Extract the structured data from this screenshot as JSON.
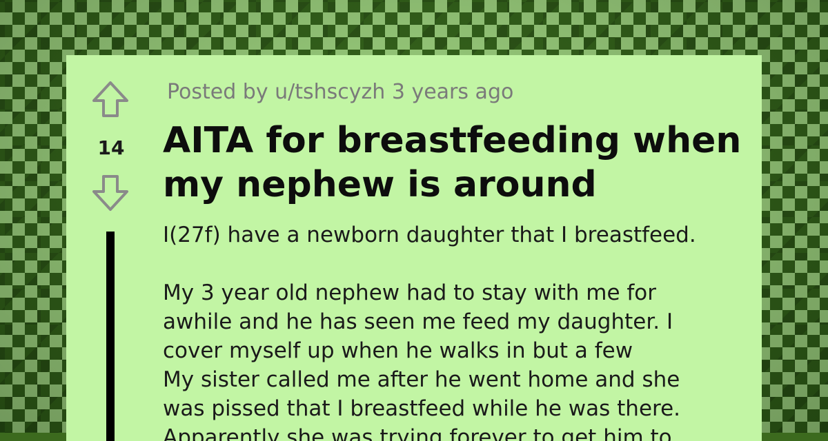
{
  "post": {
    "meta": "Posted by u/tshscyzh 3 years ago",
    "score": "14",
    "title": "AITA for breastfeeding when my nephew is around",
    "body": {
      "para1": "I(27f) have a newborn daughter that I breastfeed.",
      "para2_lines": [
        "My 3 year old nephew had to stay with me for",
        "awhile and he has seen me feed my daughter. I",
        "cover myself up when he walks in but a few",
        "My sister called me after he went home and she",
        "was pissed that I breastfeed while he was there.",
        "Apparently she was trying forever to get him to"
      ]
    }
  },
  "icons": {
    "upvote": "upvote-arrow-icon",
    "downvote": "downvote-arrow-icon"
  },
  "colors": {
    "card_background": "#c2f5a4",
    "meta_text": "#7a7a7a",
    "arrow_stroke": "#8a8a8a"
  }
}
